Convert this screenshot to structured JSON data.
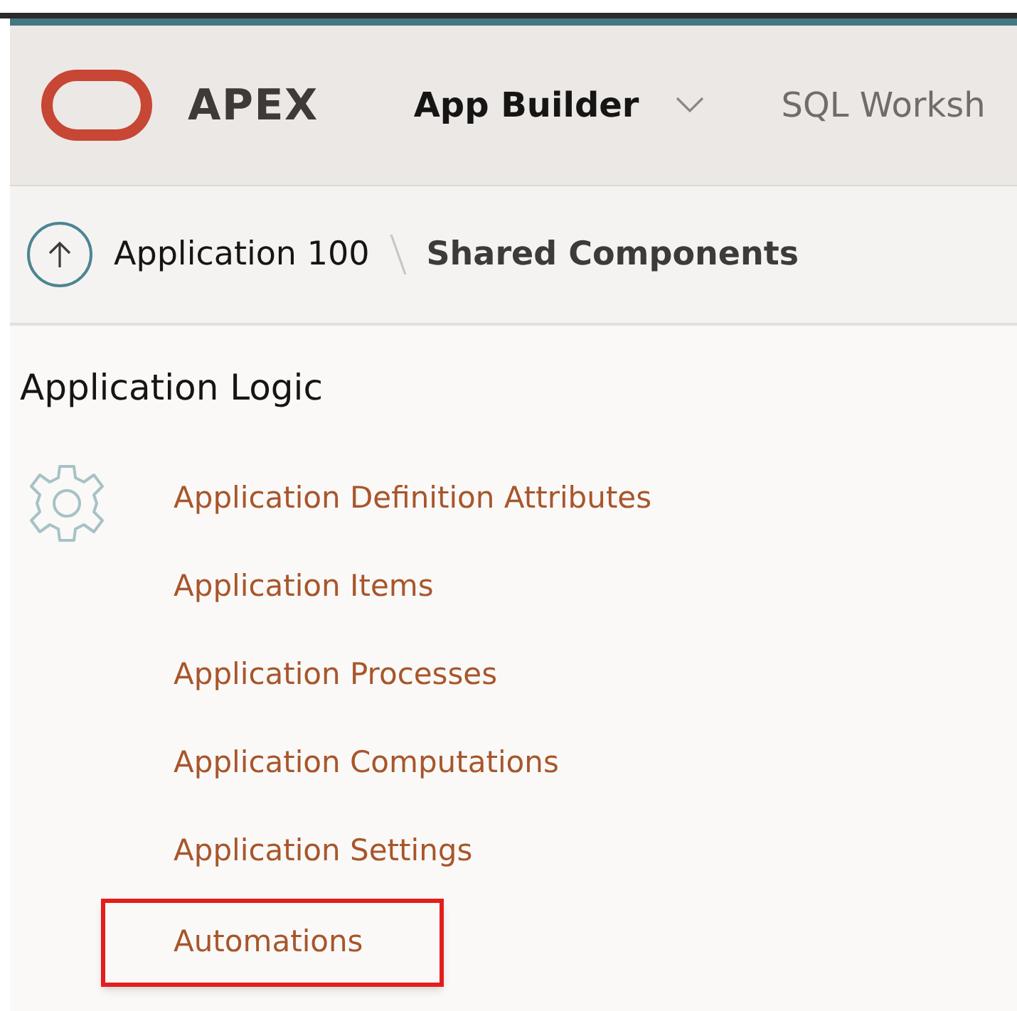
{
  "header": {
    "product": "APEX",
    "nav": [
      {
        "label": "App Builder",
        "selected": true,
        "has_menu": true
      },
      {
        "label": "SQL Worksh",
        "selected": false
      }
    ]
  },
  "breadcrumb": {
    "items": [
      {
        "label": "Application 100",
        "current": false
      },
      {
        "label": "Shared Components",
        "current": true
      }
    ]
  },
  "section": {
    "title": "Application Logic",
    "links": [
      {
        "label": "Application Definition Attributes",
        "highlighted": false
      },
      {
        "label": "Application Items",
        "highlighted": false
      },
      {
        "label": "Application Processes",
        "highlighted": false
      },
      {
        "label": "Application Computations",
        "highlighted": false
      },
      {
        "label": "Application Settings",
        "highlighted": false
      },
      {
        "label": "Automations",
        "highlighted": true
      }
    ]
  }
}
